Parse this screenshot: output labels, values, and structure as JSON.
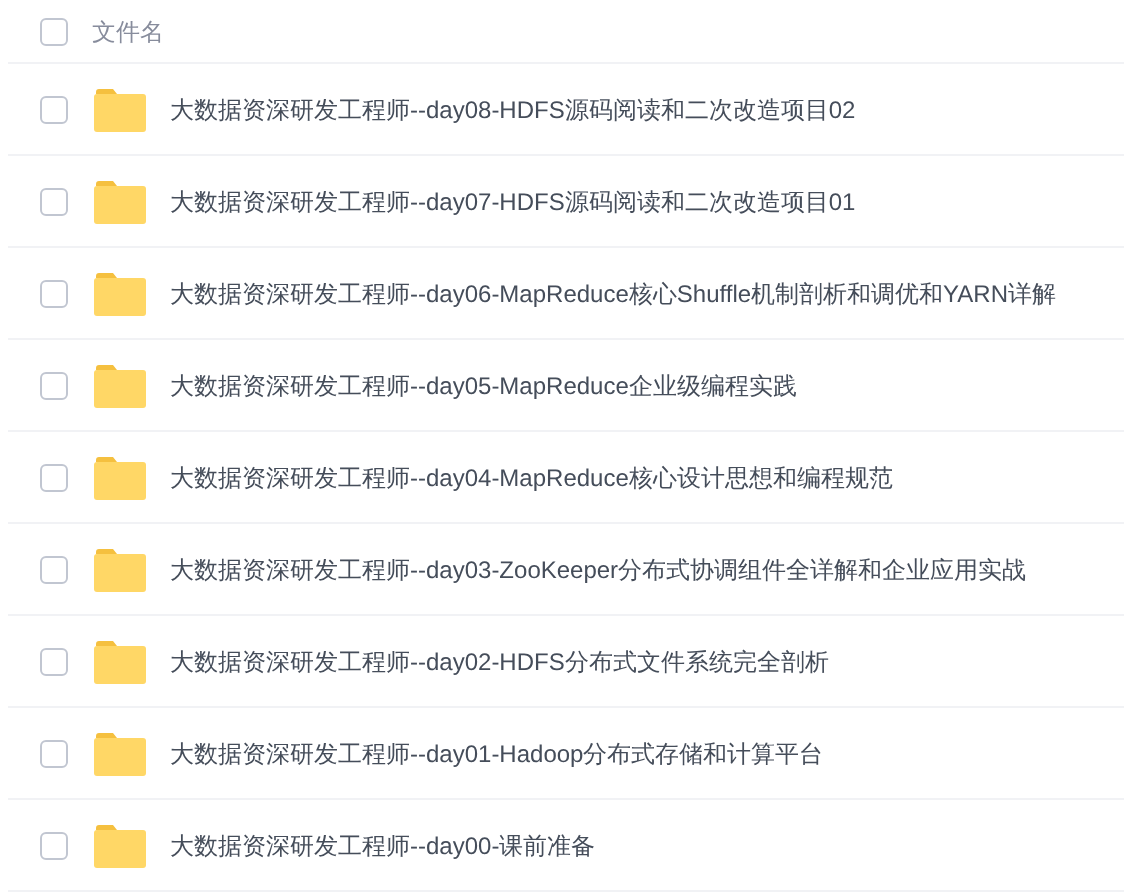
{
  "header": {
    "checked": false,
    "label": "文件名"
  },
  "files": [
    {
      "name": "大数据资深研发工程师--day08-HDFS源码阅读和二次改造项目02",
      "checked": false
    },
    {
      "name": "大数据资深研发工程师--day07-HDFS源码阅读和二次改造项目01",
      "checked": false
    },
    {
      "name": "大数据资深研发工程师--day06-MapReduce核心Shuffle机制剖析和调优和YARN详解",
      "checked": false
    },
    {
      "name": "大数据资深研发工程师--day05-MapReduce企业级编程实践",
      "checked": false
    },
    {
      "name": "大数据资深研发工程师--day04-MapReduce核心设计思想和编程规范",
      "checked": false
    },
    {
      "name": "大数据资深研发工程师--day03-ZooKeeper分布式协调组件全详解和企业应用实战",
      "checked": false
    },
    {
      "name": "大数据资深研发工程师--day02-HDFS分布式文件系统完全剖析",
      "checked": false
    },
    {
      "name": "大数据资深研发工程师--day01-Hadoop分布式存储和计算平台",
      "checked": false
    },
    {
      "name": "大数据资深研发工程师--day00-课前准备",
      "checked": false
    }
  ]
}
